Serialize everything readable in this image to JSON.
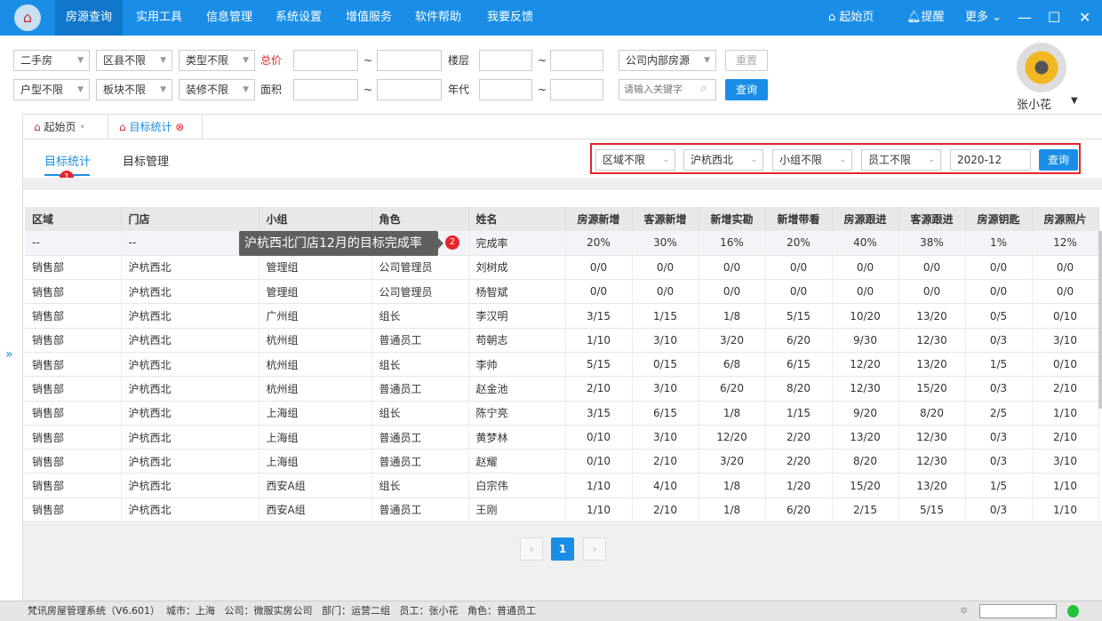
{
  "app": {
    "logo_text": "⌂"
  },
  "topnav": {
    "items": [
      "房源查询",
      "实用工具",
      "信息管理",
      "系统设置",
      "增值服务",
      "软件帮助",
      "我要反馈"
    ],
    "active": 0
  },
  "topright": {
    "home": "起始页",
    "remind": "提醒",
    "more": "更多"
  },
  "filters": {
    "row1": {
      "type": "二手房",
      "district": "区县不限",
      "category": "类型不限",
      "price_label": "总价",
      "floor_label": "楼层",
      "source": "公司内部房源",
      "reset": "重置",
      "tilde": "~"
    },
    "row2": {
      "layout": "户型不限",
      "block": "板块不限",
      "decor": "装修不限",
      "area_label": "面积",
      "year_label": "年代",
      "keyword_placeholder": "请输入关键字",
      "search": "查询",
      "tilde": "~"
    }
  },
  "user": {
    "name": "张小花"
  },
  "tabs": [
    {
      "label": "起始页"
    },
    {
      "label": "目标统计",
      "active": true
    }
  ],
  "subtabs": {
    "items": [
      "目标统计",
      "目标管理"
    ],
    "active": 0,
    "badge": "1"
  },
  "stat_filters": {
    "region": "区域不限",
    "store": "沪杭西北",
    "group": "小组不限",
    "staff": "员工不限",
    "month": "2020-12",
    "search": "查询"
  },
  "tooltip": {
    "text": "沪杭西北门店12月的目标完成率",
    "badge": "2"
  },
  "table": {
    "columns": [
      "区域",
      "门店",
      "小组",
      "角色",
      "姓名",
      "房源新增",
      "客源新增",
      "新增实勘",
      "新增带看",
      "房源跟进",
      "客源跟进",
      "房源钥匙",
      "房源照片"
    ],
    "rows": [
      [
        "--",
        "--",
        "",
        "",
        "完成率",
        "20%",
        "30%",
        "16%",
        "20%",
        "40%",
        "38%",
        "1%",
        "12%"
      ],
      [
        "销售部",
        "沪杭西北",
        "管理组",
        "公司管理员",
        "刘树成",
        "0/0",
        "0/0",
        "0/0",
        "0/0",
        "0/0",
        "0/0",
        "0/0",
        "0/0"
      ],
      [
        "销售部",
        "沪杭西北",
        "管理组",
        "公司管理员",
        "杨智斌",
        "0/0",
        "0/0",
        "0/0",
        "0/0",
        "0/0",
        "0/0",
        "0/0",
        "0/0"
      ],
      [
        "销售部",
        "沪杭西北",
        "广州组",
        "组长",
        "李汉明",
        "3/15",
        "1/15",
        "1/8",
        "5/15",
        "10/20",
        "13/20",
        "0/5",
        "0/10"
      ],
      [
        "销售部",
        "沪杭西北",
        "杭州组",
        "普通员工",
        "苟朝志",
        "1/10",
        "3/10",
        "3/20",
        "6/20",
        "9/30",
        "12/30",
        "0/3",
        "3/10"
      ],
      [
        "销售部",
        "沪杭西北",
        "杭州组",
        "组长",
        "李帅",
        "5/15",
        "0/15",
        "6/8",
        "6/15",
        "12/20",
        "13/20",
        "1/5",
        "0/10"
      ],
      [
        "销售部",
        "沪杭西北",
        "杭州组",
        "普通员工",
        "赵金池",
        "2/10",
        "3/10",
        "6/20",
        "8/20",
        "12/30",
        "15/20",
        "0/3",
        "2/10"
      ],
      [
        "销售部",
        "沪杭西北",
        "上海组",
        "组长",
        "陈宁亮",
        "3/15",
        "6/15",
        "1/8",
        "1/15",
        "9/20",
        "8/20",
        "2/5",
        "1/10"
      ],
      [
        "销售部",
        "沪杭西北",
        "上海组",
        "普通员工",
        "黄梦林",
        "0/10",
        "3/10",
        "12/20",
        "2/20",
        "13/20",
        "12/30",
        "0/3",
        "2/10"
      ],
      [
        "销售部",
        "沪杭西北",
        "上海组",
        "普通员工",
        "赵耀",
        "0/10",
        "2/10",
        "3/20",
        "2/20",
        "8/20",
        "12/30",
        "0/3",
        "3/10"
      ],
      [
        "销售部",
        "沪杭西北",
        "西安A组",
        "组长",
        "白宗伟",
        "1/10",
        "4/10",
        "1/8",
        "1/20",
        "15/20",
        "13/20",
        "1/5",
        "1/10"
      ],
      [
        "销售部",
        "沪杭西北",
        "西安A组",
        "普通员工",
        "王刚",
        "1/10",
        "2/10",
        "1/8",
        "6/20",
        "2/15",
        "5/15",
        "0/3",
        "1/10"
      ]
    ]
  },
  "pagination": {
    "prev": "‹",
    "current": "1",
    "next": "›"
  },
  "statusbar": {
    "text": "梵讯房屋管理系统（V6.601）  城市：上海   公司：微服实房公司   部门：运营二组   员工：张小花   角色：普通员工"
  },
  "colors": {
    "primary": "#1a8ee6",
    "highlight_border": "#e5252a",
    "online": "#22c33a"
  }
}
